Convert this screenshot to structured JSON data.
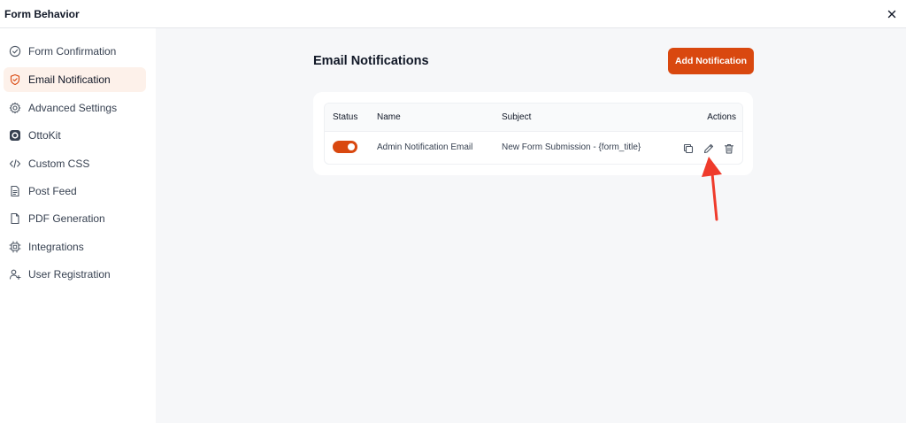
{
  "window": {
    "title": "Form Behavior"
  },
  "sidebar": {
    "items": [
      {
        "label": "Form Confirmation",
        "icon": "check-circle-icon",
        "active": false
      },
      {
        "label": "Email Notification",
        "icon": "shield-icon",
        "active": true
      },
      {
        "label": "Advanced Settings",
        "icon": "gear-icon",
        "active": false
      },
      {
        "label": "OttoKit",
        "icon": "ottokit-logo-icon",
        "active": false
      },
      {
        "label": "Custom CSS",
        "icon": "code-icon",
        "active": false
      },
      {
        "label": "Post Feed",
        "icon": "document-text-icon",
        "active": false
      },
      {
        "label": "PDF Generation",
        "icon": "file-icon",
        "active": false
      },
      {
        "label": "Integrations",
        "icon": "chip-icon",
        "active": false
      },
      {
        "label": "User Registration",
        "icon": "user-plus-icon",
        "active": false
      }
    ]
  },
  "main": {
    "heading": "Email Notifications",
    "add_button": "Add Notification",
    "table": {
      "headers": {
        "status": "Status",
        "name": "Name",
        "subject": "Subject",
        "actions": "Actions"
      },
      "rows": [
        {
          "enabled": true,
          "name": "Admin Notification Email",
          "subject": "New Form Submission - {form_title}"
        }
      ]
    }
  },
  "colors": {
    "accent": "#d9480f",
    "active_bg": "#fdf1ea",
    "annotation_arrow": "#ef3b2c"
  }
}
